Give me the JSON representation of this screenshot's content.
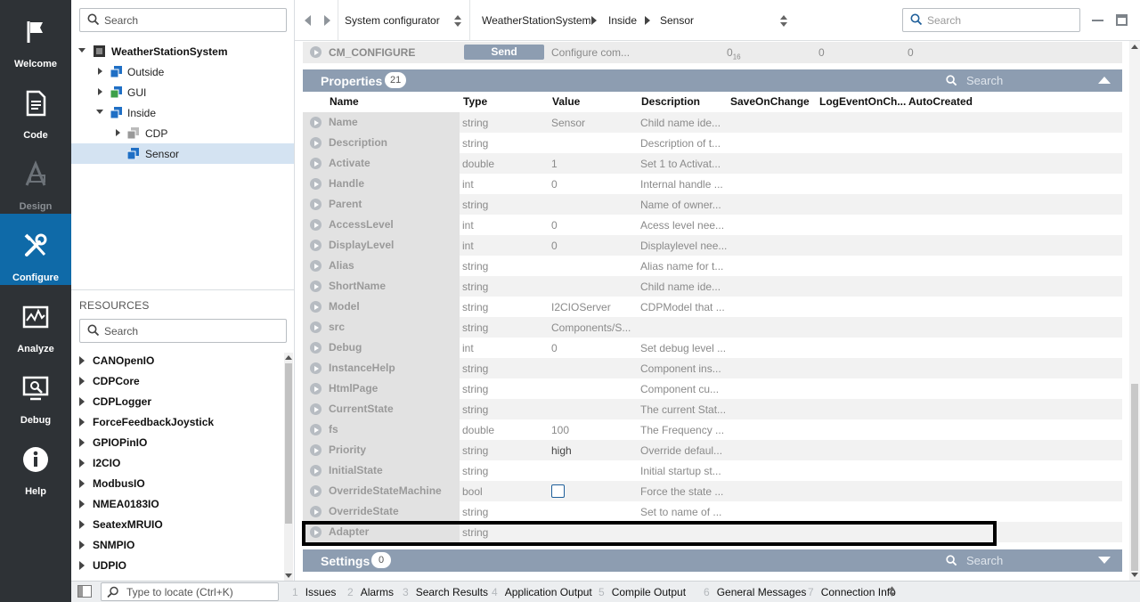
{
  "nav": {
    "items": [
      {
        "label": "Welcome",
        "icon": "flag-icon"
      },
      {
        "label": "Code",
        "icon": "document-icon"
      },
      {
        "label": "Design",
        "icon": "design-icon"
      },
      {
        "label": "Configure",
        "icon": "tools-icon"
      },
      {
        "label": "Analyze",
        "icon": "chart-icon"
      },
      {
        "label": "Debug",
        "icon": "debug-icon"
      },
      {
        "label": "Help",
        "icon": "info-icon"
      }
    ],
    "active": "Configure"
  },
  "tree": {
    "search_placeholder": "Search",
    "nodes": [
      {
        "label": "WeatherStationSystem"
      },
      {
        "label": "Outside"
      },
      {
        "label": "GUI"
      },
      {
        "label": "Inside"
      },
      {
        "label": "CDP"
      },
      {
        "label": "Sensor"
      }
    ],
    "selected": "Sensor"
  },
  "resources": {
    "title": "RESOURCES",
    "search_placeholder": "Search",
    "items": [
      "CANOpenIO",
      "CDPCore",
      "CDPLogger",
      "ForceFeedbackJoystick",
      "GPIOPinIO",
      "I2CIO",
      "ModbusIO",
      "NMEA0183IO",
      "SeatexMRUIO",
      "SNMPIO",
      "UDPIO"
    ]
  },
  "toolbar": {
    "mode": "System configurator",
    "breadcrumb": [
      "WeatherStationSystem",
      "Inside",
      "Sensor"
    ],
    "search_placeholder": "Search"
  },
  "cm_configure": {
    "name": "CM_CONFIGURE",
    "button": "Send",
    "description": "Configure com...",
    "value1": "0",
    "value1_sub": "16",
    "value2": "0",
    "value3": "0"
  },
  "properties": {
    "title": "Properties",
    "count": "21",
    "search_placeholder": "Search",
    "columns": [
      "Name",
      "Type",
      "Value",
      "Description",
      "SaveOnChange",
      "LogEventOnCh...",
      "AutoCreated"
    ],
    "rows": [
      {
        "name": "Name",
        "type": "string",
        "value": "Sensor",
        "desc": "Child name ide..."
      },
      {
        "name": "Description",
        "type": "string",
        "value": "",
        "desc": "Description of t..."
      },
      {
        "name": "Activate",
        "type": "double",
        "value": "1",
        "desc": "Set 1 to Activat..."
      },
      {
        "name": "Handle",
        "type": "int",
        "value": "0",
        "desc": "Internal handle ..."
      },
      {
        "name": "Parent",
        "type": "string",
        "value": "",
        "desc": "Name of owner..."
      },
      {
        "name": "AccessLevel",
        "type": "int",
        "value": "0",
        "desc": "Acess level nee..."
      },
      {
        "name": "DisplayLevel",
        "type": "int",
        "value": "0",
        "desc": "Displaylevel nee..."
      },
      {
        "name": "Alias",
        "type": "string",
        "value": "",
        "desc": "Alias name for t..."
      },
      {
        "name": "ShortName",
        "type": "string",
        "value": "",
        "desc": "Child name ide..."
      },
      {
        "name": "Model",
        "type": "string",
        "value": "I2CIOServer",
        "desc": "CDPModel that ..."
      },
      {
        "name": "src",
        "type": "string",
        "value": "Components/S...",
        "desc": ""
      },
      {
        "name": "Debug",
        "type": "int",
        "value": "0",
        "desc": "Set debug level ..."
      },
      {
        "name": "InstanceHelp",
        "type": "string",
        "value": "",
        "desc": "Component ins..."
      },
      {
        "name": "HtmlPage",
        "type": "string",
        "value": "",
        "desc": "Component cu..."
      },
      {
        "name": "CurrentState",
        "type": "string",
        "value": "",
        "desc": "The current Stat..."
      },
      {
        "name": "fs",
        "type": "double",
        "value": "100",
        "desc": "The Frequency ..."
      },
      {
        "name": "Priority",
        "type": "string",
        "value": "high",
        "desc": "Override defaul..."
      },
      {
        "name": "InitialState",
        "type": "string",
        "value": "",
        "desc": "Initial startup st..."
      },
      {
        "name": "OverrideStateMachine",
        "type": "bool",
        "value": "",
        "desc": "Force the state ..."
      },
      {
        "name": "OverrideState",
        "type": "string",
        "value": "",
        "desc": "Set to name of ..."
      },
      {
        "name": "Adapter",
        "type": "string",
        "value": "",
        "desc": ""
      }
    ]
  },
  "settings": {
    "title": "Settings",
    "count": "0",
    "search_placeholder": "Search"
  },
  "statusbar": {
    "locate_placeholder": "Type to locate (Ctrl+K)",
    "tabs": [
      {
        "num": "1",
        "label": "Issues"
      },
      {
        "num": "2",
        "label": "Alarms"
      },
      {
        "num": "3",
        "label": "Search Results"
      },
      {
        "num": "4",
        "label": "Application Output"
      },
      {
        "num": "5",
        "label": "Compile Output"
      },
      {
        "num": "6",
        "label": "General Messages"
      },
      {
        "num": "7",
        "label": "Connection Info"
      }
    ]
  },
  "colors": {
    "rail_bg": "#2e3236",
    "rail_active": "#0f6aa8",
    "section_header": "#8d9db1",
    "selection": "#d4e3f2"
  }
}
